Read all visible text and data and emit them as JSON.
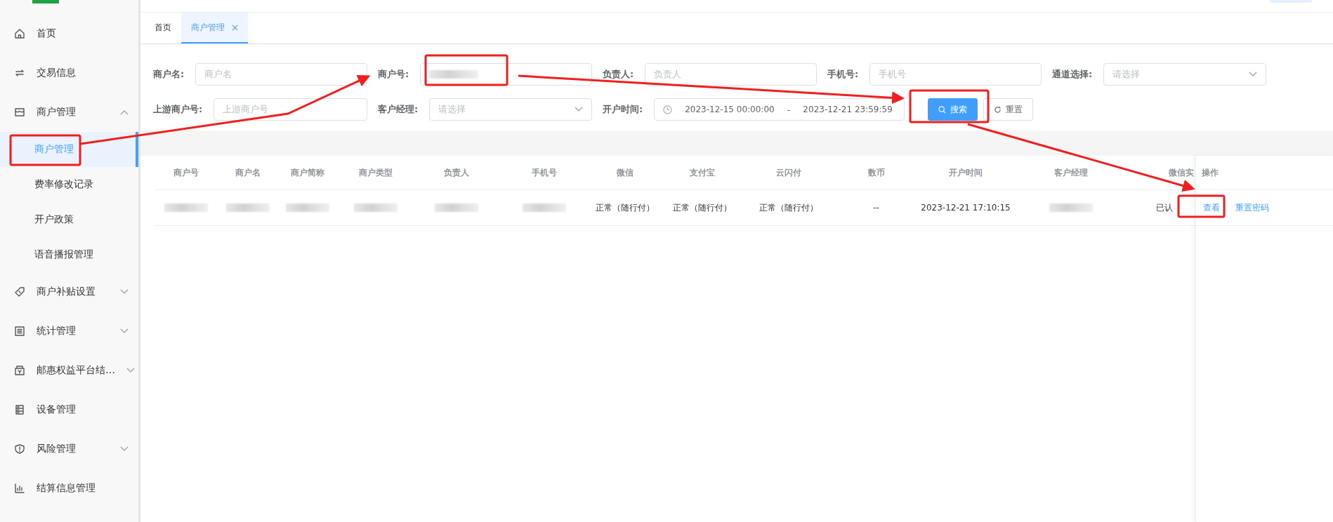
{
  "sidebar": {
    "items": [
      {
        "label": "首页",
        "kind": "link",
        "selected": false
      },
      {
        "label": "交易信息",
        "kind": "link",
        "selected": false
      },
      {
        "label": "商户管理",
        "kind": "group",
        "expanded": true,
        "selected": false,
        "children": [
          {
            "label": "商户管理",
            "selected": true
          },
          {
            "label": "费率修改记录",
            "selected": false
          },
          {
            "label": "开户政策",
            "selected": false
          },
          {
            "label": "语音播报管理",
            "selected": false
          }
        ]
      },
      {
        "label": "商户补贴设置",
        "kind": "group",
        "expanded": false,
        "selected": false
      },
      {
        "label": "统计管理",
        "kind": "group",
        "expanded": false,
        "selected": false
      },
      {
        "label": "邮惠权益平台结…",
        "kind": "group",
        "expanded": false,
        "selected": false
      },
      {
        "label": "设备管理",
        "kind": "link",
        "selected": false
      },
      {
        "label": "风险管理",
        "kind": "group",
        "expanded": false,
        "selected": false
      },
      {
        "label": "结算信息管理",
        "kind": "link",
        "selected": false
      }
    ]
  },
  "tabs": [
    {
      "label": "首页",
      "selected": false,
      "closable": false
    },
    {
      "label": "商户管理",
      "selected": true,
      "closable": true
    }
  ],
  "filter_rows": [
    [
      {
        "kind": "input",
        "label": "商户名:",
        "placeholder": "商户名"
      },
      {
        "kind": "input",
        "label": "商户号:",
        "redacted": true
      },
      {
        "kind": "input",
        "label": "负责人:",
        "placeholder": "负责人"
      },
      {
        "kind": "input",
        "label": "手机号:",
        "placeholder": "手机号"
      },
      {
        "kind": "select",
        "label": "通道选择:",
        "placeholder": "请选择"
      }
    ],
    [
      {
        "kind": "input",
        "label": "上游商户号:",
        "placeholder": "上游商户号"
      },
      {
        "kind": "select",
        "label": "客户经理:",
        "placeholder": "请选择"
      },
      {
        "kind": "daterange",
        "label": "开户时间:",
        "start": "2023-12-15 00:00:00",
        "separator": "-",
        "end": "2023-12-21 23:59:59"
      }
    ]
  ],
  "buttons": [
    {
      "kind": "primary",
      "label": "搜索"
    },
    {
      "kind": "plain",
      "label": "重置"
    }
  ],
  "table": {
    "columns": [
      "商户号",
      "商户名",
      "商户简称",
      "商户类型",
      "负责人",
      "手机号",
      "微信",
      "支付宝",
      "云闪付",
      "数币",
      "开户时间",
      "客户经理",
      "微信实"
    ],
    "rows": [
      {
        "cells": [
          {
            "kind": "redacted"
          },
          {
            "kind": "redacted"
          },
          {
            "kind": "redacted"
          },
          {
            "kind": "redacted"
          },
          {
            "kind": "redacted"
          },
          {
            "kind": "redacted"
          },
          {
            "kind": "text",
            "text": "正常（随行付）"
          },
          {
            "kind": "text",
            "text": "正常（随行付）"
          },
          {
            "kind": "text",
            "text": "正常（随行付）"
          },
          {
            "kind": "text",
            "text": "--"
          },
          {
            "kind": "text",
            "text": "2023-12-21 17:10:15"
          },
          {
            "kind": "redacted"
          },
          {
            "kind": "text",
            "text": "已认"
          }
        ],
        "actions": [
          "查看",
          "重置密码"
        ]
      }
    ],
    "action_column": "操作"
  }
}
